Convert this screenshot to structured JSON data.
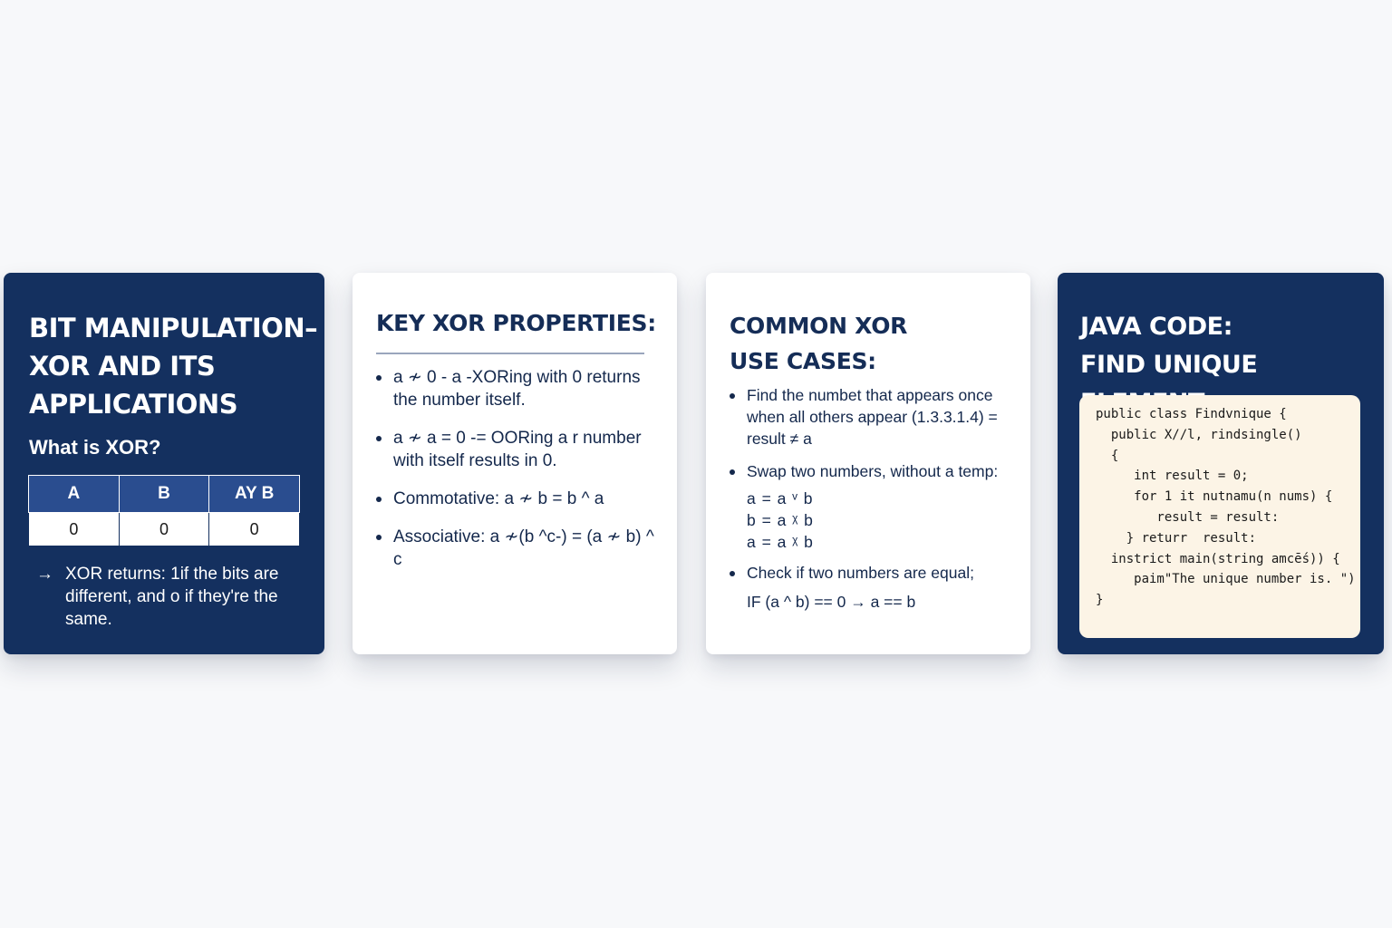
{
  "colors": {
    "page_background": "#f7f8fa",
    "dark_card": "#14305f",
    "table_header": "#2a4d8f",
    "code_background": "#fcf4e6",
    "text_dark": "#14284c"
  },
  "card1": {
    "title_lines": [
      "BIT MANIPULATION–",
      "XOR AND ITS",
      "APPLICATIONS"
    ],
    "subtitle": "What is XOR?",
    "table": {
      "headers": [
        "A",
        "B",
        "AY B"
      ],
      "row": [
        "0",
        "0",
        "0"
      ]
    },
    "note_icon": "arrow-right-icon",
    "note_text": "XOR returns: 1if the bits are different, and o if they're the same."
  },
  "card2": {
    "title": "KEY XOR PROPERTIES:",
    "items": [
      "a ≁ 0 - a -XORing with 0 returns the number itself.",
      "a ≁ a = 0 -= OORing a r number with itself results in 0.",
      "Commotative: a ≁ b = b ^ a",
      "Associative: a ≁(b ^c-) = (a ≁ b) ^ c"
    ]
  },
  "card3": {
    "title_lines": [
      "COMMON XOR",
      "USE CASES:"
    ],
    "item1": "Find the numbet that appears once when all others appear (1.3.3.1.4) = result ≠ a",
    "item2": "Swap two numbers, without a temp:",
    "swap_lines": [
      "a = a ᵛ b",
      "b = a ᵡ b",
      "a = a ᵡ b"
    ],
    "item3": "Check if two numbers are equal;",
    "check_line": "IF (a ^ b) == 0 → a == b"
  },
  "card4": {
    "title_lines": [
      "JAVA CODE:",
      "FIND UNIQUE ELEMENT"
    ],
    "code_lines": [
      "public class Findvnique {",
      "  public X//l, rindsingle()",
      "  {",
      "     int result = 0;",
      "     for 1 it nutnamu(n nums) {",
      "        result = result:",
      "    } returr  result:",
      "  instrict main(string amcḗs)) {",
      "     paim\"The unique number is. \")",
      "}"
    ]
  }
}
